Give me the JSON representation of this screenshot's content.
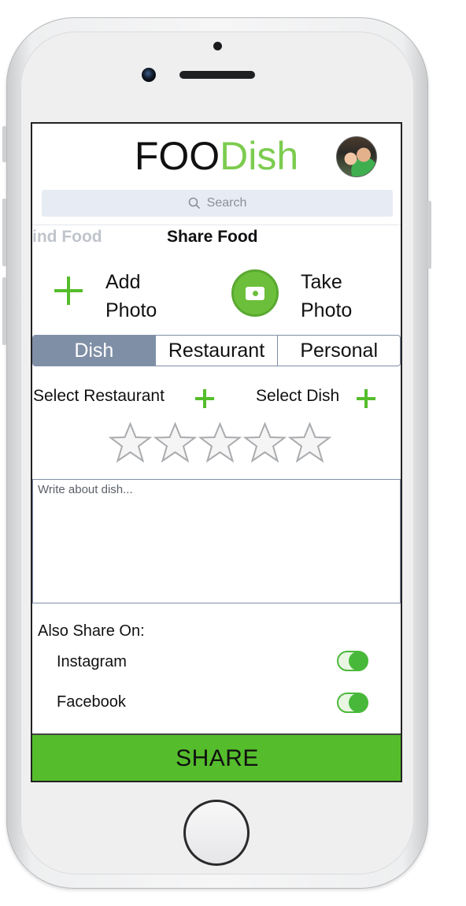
{
  "app": {
    "brand_part1": "FOO",
    "brand_part2": "Dish"
  },
  "search": {
    "placeholder": "Search"
  },
  "nav_tabs": {
    "find": "ind Food",
    "share": "Share Food"
  },
  "photo_actions": {
    "add_label": "Add Photo",
    "take_label": "Take Photo"
  },
  "segments": [
    "Dish",
    "Restaurant",
    "Personal"
  ],
  "selected_segment": "Dish",
  "selectors": {
    "restaurant_label": "Select Restaurant",
    "dish_label": "Select Dish"
  },
  "rating": {
    "value": 0,
    "max": 5
  },
  "review": {
    "placeholder": "Write about dish..."
  },
  "also_share": {
    "heading": "Also Share On:",
    "options": [
      {
        "label": "Instagram",
        "enabled": true
      },
      {
        "label": "Facebook",
        "enabled": true
      }
    ]
  },
  "share_button": "SHARE",
  "colors": {
    "accent_green": "#55bd2c",
    "brand_green": "#7ccc4f",
    "segment_active": "#7f8fa6"
  }
}
